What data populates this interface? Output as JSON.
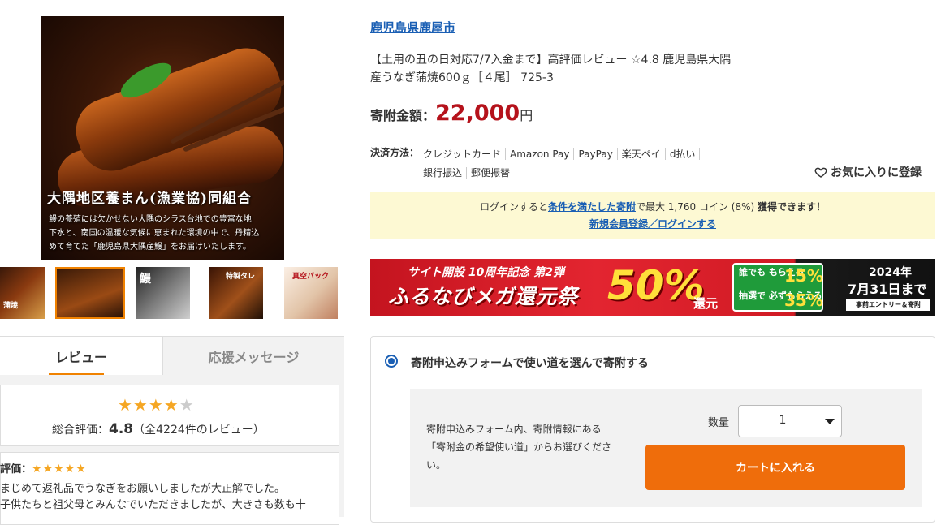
{
  "gallery": {
    "main_image": {
      "icon": "eel-rice-bowl-photo",
      "caption_title": "大隅地区養まん(漁業協)同組合",
      "caption_body": [
        "鰻の養殖には欠かせない大隅のシラス台地での豊富な地",
        "下水と、南国の温暖な気候に恵まれた環境の中で、丹精込",
        "めて育てた「鹿児島県大隅産鰻」をお届けいたします。"
      ]
    },
    "thumbnails": [
      {
        "alt": "thumbnail-1",
        "text": "蒲焼"
      },
      {
        "alt": "thumbnail-2",
        "text": ""
      },
      {
        "alt": "thumbnail-3",
        "text": "鰻"
      },
      {
        "alt": "thumbnail-4",
        "text": "特製タレ"
      },
      {
        "alt": "thumbnail-5",
        "text": "真空パック"
      }
    ]
  },
  "tabs": {
    "review": "レビュー",
    "support": "応援メッセージ"
  },
  "review_summary": {
    "stars": "★★★★",
    "half_star": "★",
    "overall_prefix": "総合評価：",
    "score": "4.8",
    "count_text": "（全4224件のレビュー）"
  },
  "review_item": {
    "eval_label": "評価：",
    "stars": "★★★★★",
    "line1": "まじめて返礼品でうなぎをお願いしましたが大正解でした。",
    "line2": "子供たちと祖父母とみんなでいただきましたが、大きさも数も十"
  },
  "product": {
    "municipality": "鹿児島県鹿屋市",
    "title_line1": "【土用の丑の日対応7/7入金まで】高評価レビュー ☆4.8 鹿児島県大隅",
    "title_line2": "産うなぎ蒲焼600ｇ［４尾］ 725-3",
    "price_label": "寄附金額：",
    "price_value": "22,000",
    "price_unit": "円"
  },
  "payment": {
    "label": "決済方法：",
    "methods": [
      "クレジットカード",
      "Amazon Pay",
      "PayPay",
      "楽天ペイ",
      "d払い",
      "銀行振込",
      "郵便振替"
    ]
  },
  "favorite": {
    "label": "お気に入りに登録",
    "icon": "heart-outline-icon"
  },
  "notice": {
    "pre": "ログインすると",
    "link": "条件を満たした寄附",
    "mid": "で最大 1,760 コイン (8%)",
    "post": "獲得できます！",
    "login_link": "新規会員登録／ログインする"
  },
  "banner": {
    "sub": "サイト開設 10周年記念 第2弾",
    "main": "ふるなびメガ還元祭",
    "off": "50%",
    "kangen": "還元",
    "green1": "誰でも もらえる",
    "pct1": "15%",
    "green2": "抽選で 必ずもらえる",
    "pct2": "35%",
    "date_year": "2024年",
    "date_day": "7月31日まで",
    "entry": "事前エントリー＆寄附"
  },
  "donation_form": {
    "option_label": "寄附申込みフォームで使い道を選んで寄附する",
    "description": "寄附申込みフォーム内、寄附情報にある「寄附金の希望使い道」からお選びください。",
    "qty_label": "数量",
    "qty_value": "1",
    "cart_button": "カートに入れる"
  },
  "colors": {
    "accent_orange": "#ef6d0b",
    "link_blue": "#1a5fb4",
    "price_red": "#b5121b",
    "star_gold": "#f5a623",
    "notice_bg": "#fdf9d3"
  }
}
